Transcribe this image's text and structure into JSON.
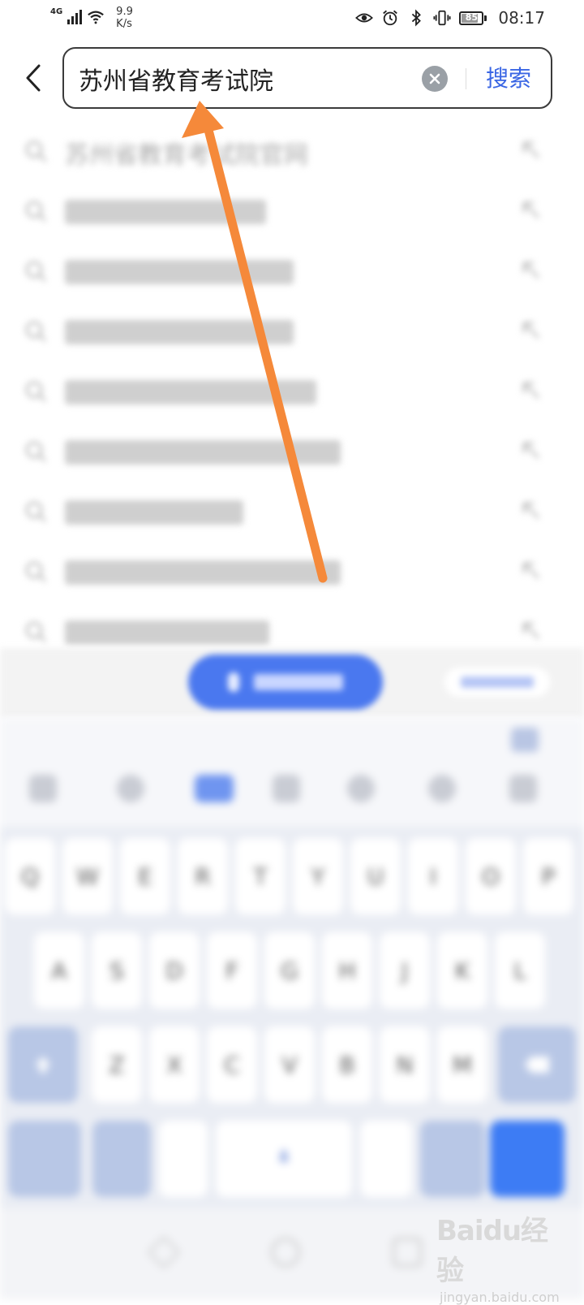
{
  "status_bar": {
    "network": "4G",
    "speed_value": "9.9",
    "speed_unit": "K/s",
    "battery": "85",
    "time": "08:17",
    "icons": [
      "eye-icon",
      "alarm-icon",
      "bluetooth-icon",
      "vibrate-icon",
      "battery-icon"
    ]
  },
  "search": {
    "query": "苏州省教育考试院",
    "search_label": "搜索",
    "clear_icon": "clear-icon",
    "back_icon": "back-arrow-icon"
  },
  "suggestions": {
    "first": "苏州省教育考试院官网",
    "blurred_count": 8
  },
  "keyboard": {
    "row1": [
      "Q",
      "W",
      "E",
      "R",
      "T",
      "Y",
      "U",
      "I",
      "O",
      "P"
    ],
    "row2": [
      "A",
      "S",
      "D",
      "F",
      "G",
      "H",
      "J",
      "K",
      "L"
    ],
    "row3": [
      "Z",
      "X",
      "C",
      "V",
      "B",
      "N",
      "M"
    ]
  },
  "annotation": {
    "arrow_color": "#f5893a"
  },
  "watermark": {
    "logo": "Baidu经验",
    "url": "jingyan.baidu.com"
  },
  "colors": {
    "accent": "#3a66e4",
    "keyboard_enter": "#3d7cf4",
    "voice_button": "#4a78ef"
  }
}
